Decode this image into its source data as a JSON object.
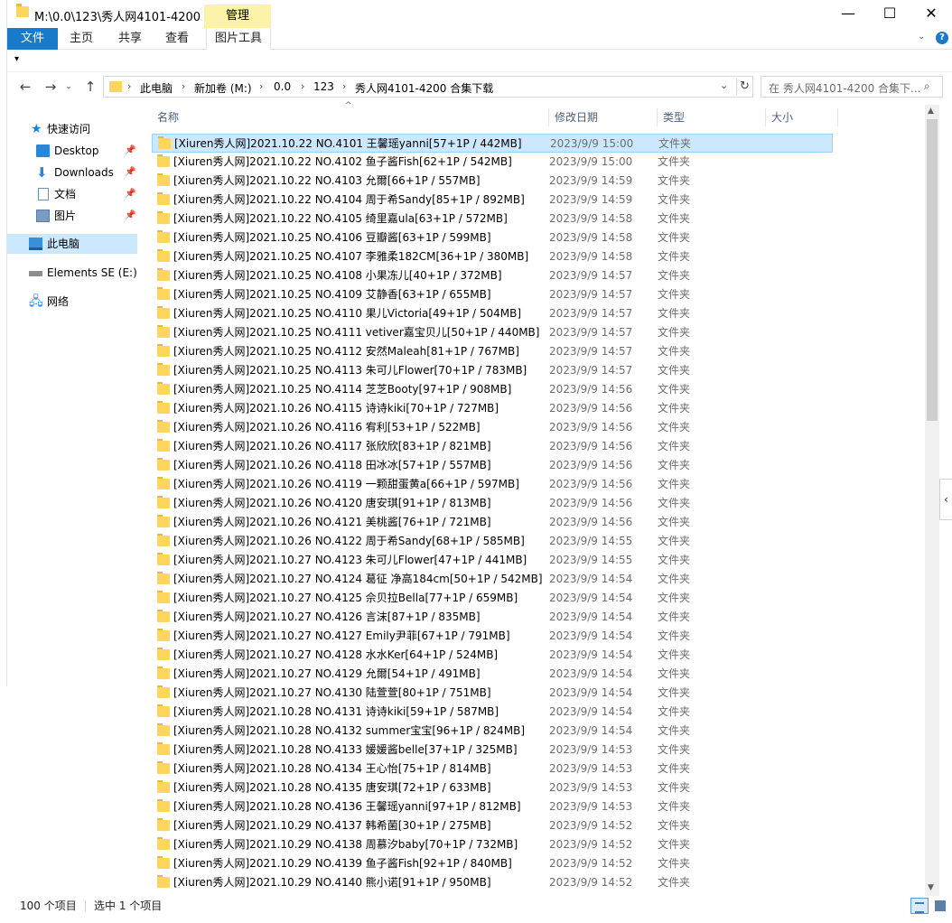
{
  "window": {
    "title": "M:\\0.0\\123\\秀人网4101-4200 合集下载",
    "context_tab": "管理",
    "controls": {
      "minimize": "—",
      "maximize": "☐",
      "close": "✕"
    }
  },
  "ribbon": {
    "tabs": [
      "文件",
      "主页",
      "共享",
      "查看",
      "图片工具"
    ]
  },
  "address": {
    "crumbs": [
      "此电脑",
      "新加卷 (M:)",
      "0.0",
      "123",
      "秀人网4101-4200 合集下载"
    ],
    "search_placeholder": "在 秀人网4101-4200 合集下..."
  },
  "nav_pane": {
    "quick_access": "快速访问",
    "items": [
      {
        "label": "Desktop",
        "icon": "desktop-icon",
        "pinned": true
      },
      {
        "label": "Downloads",
        "icon": "download-icon",
        "pinned": true
      },
      {
        "label": "文档",
        "icon": "documents-icon",
        "pinned": true
      },
      {
        "label": "图片",
        "icon": "pictures-icon",
        "pinned": true
      }
    ],
    "this_pc": "此电脑",
    "drive": "Elements SE (E:)",
    "network": "网络"
  },
  "columns": {
    "name": "名称",
    "date": "修改日期",
    "type": "类型",
    "size": "大小"
  },
  "files": [
    {
      "name": "[Xiuren秀人网]2021.10.22 NO.4101 王馨瑶yanni[57+1P / 442MB]",
      "date": "2023/9/9 15:00",
      "type": "文件夹",
      "selected": true
    },
    {
      "name": "[Xiuren秀人网]2021.10.22 NO.4102 鱼子酱Fish[62+1P / 542MB]",
      "date": "2023/9/9 15:00",
      "type": "文件夹"
    },
    {
      "name": "[Xiuren秀人网]2021.10.22 NO.4103 允爾[66+1P / 557MB]",
      "date": "2023/9/9 14:59",
      "type": "文件夹"
    },
    {
      "name": "[Xiuren秀人网]2021.10.22 NO.4104 周于希Sandy[85+1P / 892MB]",
      "date": "2023/9/9 14:59",
      "type": "文件夹"
    },
    {
      "name": "[Xiuren秀人网]2021.10.22 NO.4105 绮里嘉ula[63+1P / 572MB]",
      "date": "2023/9/9 14:58",
      "type": "文件夹"
    },
    {
      "name": "[Xiuren秀人网]2021.10.25 NO.4106 豆瓣酱[63+1P / 599MB]",
      "date": "2023/9/9 14:58",
      "type": "文件夹"
    },
    {
      "name": "[Xiuren秀人网]2021.10.25 NO.4107 李雅柔182CM[36+1P / 380MB]",
      "date": "2023/9/9 14:58",
      "type": "文件夹"
    },
    {
      "name": "[Xiuren秀人网]2021.10.25 NO.4108 小果冻儿[40+1P / 372MB]",
      "date": "2023/9/9 14:57",
      "type": "文件夹"
    },
    {
      "name": "[Xiuren秀人网]2021.10.25 NO.4109 艾静香[63+1P / 655MB]",
      "date": "2023/9/9 14:57",
      "type": "文件夹"
    },
    {
      "name": "[Xiuren秀人网]2021.10.25 NO.4110 果儿Victoria[49+1P / 504MB]",
      "date": "2023/9/9 14:57",
      "type": "文件夹"
    },
    {
      "name": "[Xiuren秀人网]2021.10.25 NO.4111 vetiver嘉宝贝儿[50+1P / 440MB]",
      "date": "2023/9/9 14:57",
      "type": "文件夹"
    },
    {
      "name": "[Xiuren秀人网]2021.10.25 NO.4112 安然Maleah[81+1P / 767MB]",
      "date": "2023/9/9 14:57",
      "type": "文件夹"
    },
    {
      "name": "[Xiuren秀人网]2021.10.25 NO.4113 朱可儿Flower[70+1P / 783MB]",
      "date": "2023/9/9 14:57",
      "type": "文件夹"
    },
    {
      "name": "[Xiuren秀人网]2021.10.25 NO.4114 芝芝Booty[97+1P / 908MB]",
      "date": "2023/9/9 14:56",
      "type": "文件夹"
    },
    {
      "name": "[Xiuren秀人网]2021.10.26 NO.4115 诗诗kiki[70+1P / 727MB]",
      "date": "2023/9/9 14:56",
      "type": "文件夹"
    },
    {
      "name": "[Xiuren秀人网]2021.10.26 NO.4116 宥利[53+1P / 522MB]",
      "date": "2023/9/9 14:56",
      "type": "文件夹"
    },
    {
      "name": "[Xiuren秀人网]2021.10.26 NO.4117 张欣欣[83+1P / 821MB]",
      "date": "2023/9/9 14:56",
      "type": "文件夹"
    },
    {
      "name": "[Xiuren秀人网]2021.10.26 NO.4118 田冰冰[57+1P / 557MB]",
      "date": "2023/9/9 14:56",
      "type": "文件夹"
    },
    {
      "name": "[Xiuren秀人网]2021.10.26 NO.4119 一颗甜蛋黄a[66+1P / 597MB]",
      "date": "2023/9/9 14:56",
      "type": "文件夹"
    },
    {
      "name": "[Xiuren秀人网]2021.10.26 NO.4120 唐安琪[91+1P / 813MB]",
      "date": "2023/9/9 14:56",
      "type": "文件夹"
    },
    {
      "name": "[Xiuren秀人网]2021.10.26 NO.4121 美桃酱[76+1P / 721MB]",
      "date": "2023/9/9 14:56",
      "type": "文件夹"
    },
    {
      "name": "[Xiuren秀人网]2021.10.26 NO.4122 周于希Sandy[68+1P / 585MB]",
      "date": "2023/9/9 14:55",
      "type": "文件夹"
    },
    {
      "name": "[Xiuren秀人网]2021.10.27 NO.4123 朱可儿Flower[47+1P / 441MB]",
      "date": "2023/9/9 14:55",
      "type": "文件夹"
    },
    {
      "name": "[Xiuren秀人网]2021.10.27 NO.4124 葛征 净高184cm[50+1P / 542MB]",
      "date": "2023/9/9 14:54",
      "type": "文件夹"
    },
    {
      "name": "[Xiuren秀人网]2021.10.27 NO.4125 佘贝拉Bella[77+1P / 659MB]",
      "date": "2023/9/9 14:54",
      "type": "文件夹"
    },
    {
      "name": "[Xiuren秀人网]2021.10.27 NO.4126 言沫[87+1P / 835MB]",
      "date": "2023/9/9 14:54",
      "type": "文件夹"
    },
    {
      "name": "[Xiuren秀人网]2021.10.27 NO.4127 Emily尹菲[67+1P / 791MB]",
      "date": "2023/9/9 14:54",
      "type": "文件夹"
    },
    {
      "name": "[Xiuren秀人网]2021.10.27 NO.4128 水水Ker[64+1P / 524MB]",
      "date": "2023/9/9 14:54",
      "type": "文件夹"
    },
    {
      "name": "[Xiuren秀人网]2021.10.27 NO.4129 允爾[54+1P / 491MB]",
      "date": "2023/9/9 14:54",
      "type": "文件夹"
    },
    {
      "name": "[Xiuren秀人网]2021.10.27 NO.4130 陆萱萱[80+1P / 751MB]",
      "date": "2023/9/9 14:54",
      "type": "文件夹"
    },
    {
      "name": "[Xiuren秀人网]2021.10.28 NO.4131 诗诗kiki[59+1P / 587MB]",
      "date": "2023/9/9 14:54",
      "type": "文件夹"
    },
    {
      "name": "[Xiuren秀人网]2021.10.28 NO.4132 summer宝宝[96+1P / 824MB]",
      "date": "2023/9/9 14:54",
      "type": "文件夹"
    },
    {
      "name": "[Xiuren秀人网]2021.10.28 NO.4133 媛媛酱belle[37+1P / 325MB]",
      "date": "2023/9/9 14:53",
      "type": "文件夹"
    },
    {
      "name": "[Xiuren秀人网]2021.10.28 NO.4134 王心怡[75+1P / 814MB]",
      "date": "2023/9/9 14:53",
      "type": "文件夹"
    },
    {
      "name": "[Xiuren秀人网]2021.10.28 NO.4135 唐安琪[72+1P / 633MB]",
      "date": "2023/9/9 14:53",
      "type": "文件夹"
    },
    {
      "name": "[Xiuren秀人网]2021.10.28 NO.4136 王馨瑶yanni[97+1P / 812MB]",
      "date": "2023/9/9 14:53",
      "type": "文件夹"
    },
    {
      "name": "[Xiuren秀人网]2021.10.29 NO.4137 韩希菌[30+1P / 275MB]",
      "date": "2023/9/9 14:52",
      "type": "文件夹"
    },
    {
      "name": "[Xiuren秀人网]2021.10.29 NO.4138 周慕汐baby[70+1P / 732MB]",
      "date": "2023/9/9 14:52",
      "type": "文件夹"
    },
    {
      "name": "[Xiuren秀人网]2021.10.29 NO.4139 鱼子酱Fish[92+1P / 840MB]",
      "date": "2023/9/9 14:52",
      "type": "文件夹"
    },
    {
      "name": "[Xiuren秀人网]2021.10.29 NO.4140 熊小诺[91+1P / 950MB]",
      "date": "2023/9/9 14:52",
      "type": "文件夹"
    }
  ],
  "status": {
    "count": "100 个项目",
    "selected": "选中 1 个项目"
  }
}
